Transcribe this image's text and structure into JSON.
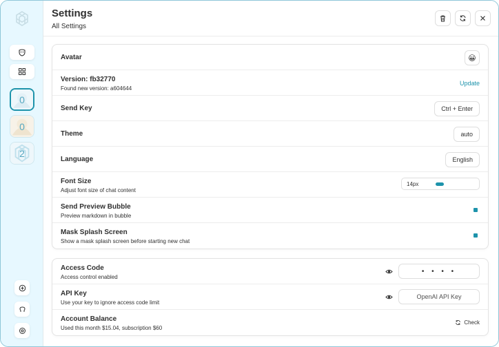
{
  "colors": {
    "accent": "#1d93ab",
    "sidebar_bg": "#e7f8ff",
    "text": "#303030"
  },
  "sidebar": {
    "logo_icon": "openai-logo-icon",
    "top_buttons": [
      {
        "icon": "mask-icon"
      },
      {
        "icon": "grid-icon"
      }
    ],
    "masks": [
      {
        "count": "0"
      },
      {
        "count": "0"
      },
      {
        "count": "2"
      }
    ],
    "bottom_buttons": [
      {
        "icon": "plus-circle-icon"
      },
      {
        "icon": "github-icon"
      },
      {
        "icon": "settings-icon"
      }
    ]
  },
  "header": {
    "title": "Settings",
    "subtitle": "All Settings",
    "actions": [
      "clear-icon",
      "reset-icon",
      "close-icon"
    ]
  },
  "settings_main": {
    "avatar": {
      "title": "Avatar",
      "value": "😀"
    },
    "version": {
      "title": "Version: fb32770",
      "subtitle": "Found new version: a604644",
      "action": "Update"
    },
    "send_key": {
      "title": "Send Key",
      "value": "Ctrl + Enter"
    },
    "theme": {
      "title": "Theme",
      "value": "auto"
    },
    "language": {
      "title": "Language",
      "value": "English"
    },
    "font_size": {
      "title": "Font Size",
      "subtitle": "Adjust font size of chat content",
      "value": "14px",
      "slider_fraction": 0.0
    },
    "send_preview_bubble": {
      "title": "Send Preview Bubble",
      "subtitle": "Preview markdown in bubble",
      "checked": true
    },
    "mask_splash": {
      "title": "Mask Splash Screen",
      "subtitle": "Show a mask splash screen before starting new chat",
      "checked": true
    }
  },
  "settings_access": {
    "access_code": {
      "title": "Access Code",
      "subtitle": "Access control enabled",
      "value": "• • • •"
    },
    "api_key": {
      "title": "API Key",
      "subtitle": "Use your key to ignore access code limit",
      "placeholder": "OpenAI API Key"
    },
    "balance": {
      "title": "Account Balance",
      "subtitle": "Used this month $15.04, subscription $60",
      "action": "Check"
    }
  }
}
